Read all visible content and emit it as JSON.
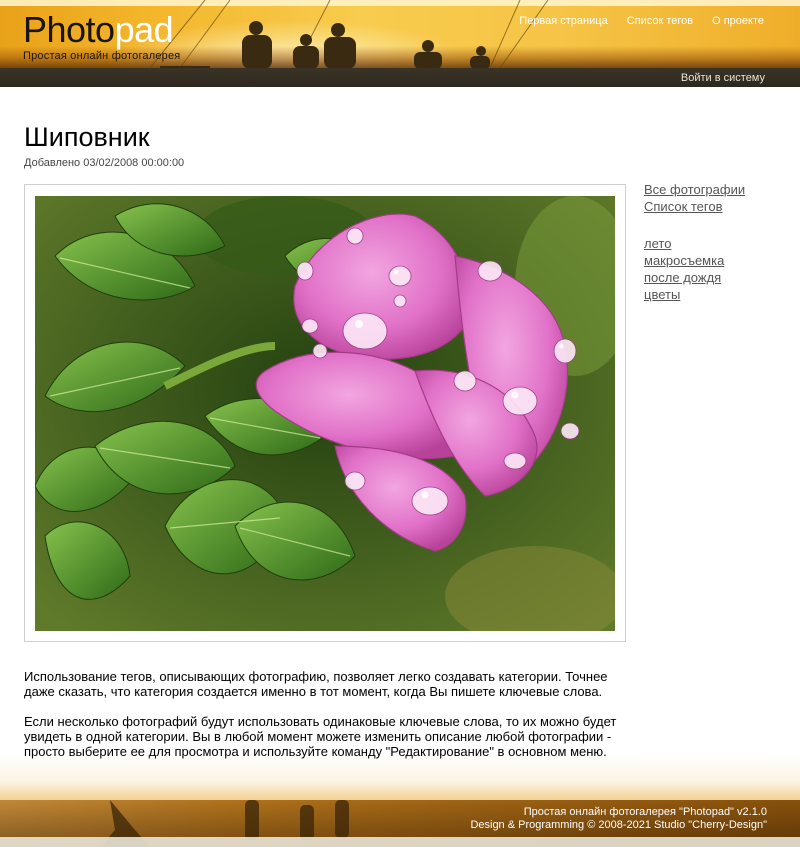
{
  "header": {
    "logo_part1": "Photo",
    "logo_part2": "pad",
    "tagline": "Простая онлайн фотогалерея",
    "nav": [
      "Первая страница",
      "Список тегов",
      "О проекте"
    ],
    "login": "Войти в систему"
  },
  "page": {
    "title": "Шиповник",
    "date_prefix": "Добавлено",
    "date": "03/02/2008 00:00:00"
  },
  "sidebar": {
    "links": [
      "Все фотографии",
      "Список тегов"
    ],
    "tags": [
      "лето",
      "макросъемка",
      "после дождя",
      "цветы"
    ]
  },
  "description": [
    "Использование тегов, описывающих фотографию, позволяет легко создавать категории. Точнее даже сказать, что категория создается именно в тот момент, когда Вы пишете ключевые слова.",
    "Если несколько фотографий будут использовать одинаковые ключевые слова, то их можно будет увидеть в одной категории. Вы в любой момент можете изменить описание любой фотографии - просто выберите ее для просмотра и используйте команду \"Редактирование\" в основном меню."
  ],
  "footer": {
    "line1": "Простая онлайн фотогалерея \"Photopad\" v2.1.0",
    "line2": "Design & Programming © 2008-2021 Studio \"Cherry-Design\""
  },
  "colors": {
    "header_orange": "#f3b52a",
    "header_bar": "#2d281e",
    "link_gray": "#555555",
    "flower_pink": "#e26cc0",
    "leaf_green": "#4f8f2a"
  }
}
